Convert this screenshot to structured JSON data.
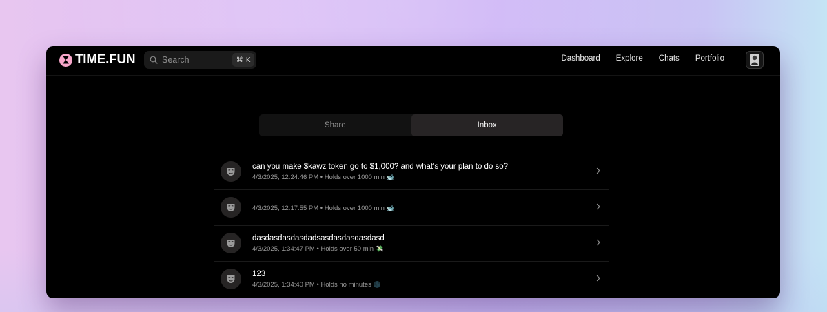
{
  "app": {
    "logo_text": "TIME.FUN",
    "brand_color": "#f7a6c9"
  },
  "search": {
    "placeholder": "Search",
    "shortcut_symbol": "⌘",
    "shortcut_key": "K"
  },
  "nav": {
    "items": [
      {
        "label": "Dashboard"
      },
      {
        "label": "Explore"
      },
      {
        "label": "Chats"
      },
      {
        "label": "Portfolio"
      }
    ]
  },
  "tabs": [
    {
      "label": "Share",
      "active": false
    },
    {
      "label": "Inbox",
      "active": true
    }
  ],
  "messages": [
    {
      "title": "can you make $kawz token go to $1,000? and what's your plan to do so?",
      "meta": "4/3/2025, 12:24:46 PM • Holds over 1000 min",
      "badge": "🐋",
      "badge_icon": "whale-icon"
    },
    {
      "title": "",
      "meta": "4/3/2025, 12:17:55 PM • Holds over 1000 min",
      "badge": "🐋",
      "badge_icon": "whale-icon"
    },
    {
      "title": "dasdasdasdasdadsasdasdasdasdasd",
      "meta": "4/3/2025, 1:34:47 PM • Holds over 50 min",
      "badge": "💸",
      "badge_icon": "money-icon"
    },
    {
      "title": "123",
      "meta": "4/3/2025, 1:34:40 PM • Holds no minutes",
      "badge": "🌑",
      "badge_icon": "moon-icon"
    }
  ]
}
